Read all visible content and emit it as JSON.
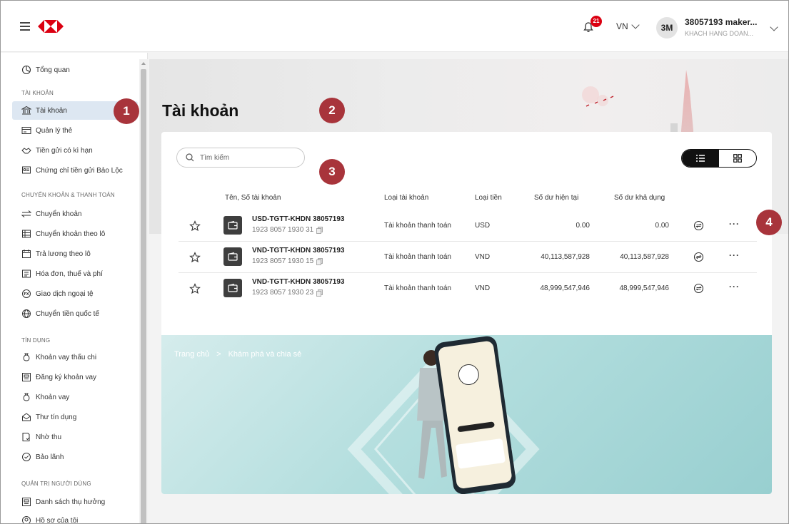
{
  "header": {
    "notifications_count": "21",
    "language": "VN",
    "avatar_initials": "3M",
    "user_name": "38057193 maker...",
    "user_company": "KHACH HANG DOAN..."
  },
  "sidebar": {
    "overview": "Tổng quan",
    "sections": {
      "accounts": "TÀI KHOẢN",
      "transfers": "CHUYỂN KHOẢN & THANH TOÁN",
      "credit": "TÍN DỤNG",
      "admin": "QUẢN TRỊ NGƯỜI DÙNG"
    },
    "accounts_items": [
      "Tài khoản",
      "Quản lý thẻ",
      "Tiền gửi có kì hạn",
      "Chứng chỉ tiền gửi Bảo Lộc"
    ],
    "transfer_items": [
      "Chuyển khoản",
      "Chuyển khoản theo lô",
      "Trả lương theo lô",
      "Hóa đơn, thuế và phí",
      "Giao dịch ngoại tệ",
      "Chuyển tiền quốc tế"
    ],
    "credit_items": [
      "Khoản vay thấu chi",
      "Đăng ký khoản vay",
      "Khoản vay",
      "Thư tín dụng",
      "Nhờ thu",
      "Bảo lãnh"
    ],
    "admin_items": [
      "Danh sách thụ hưởng",
      "Hồ sơ của tôi"
    ]
  },
  "main": {
    "title": "Tài khoản",
    "search_placeholder": "Tìm kiếm",
    "columns": {
      "name": "Tên, Số tài khoản",
      "type": "Loại tài khoản",
      "currency": "Loại tiền",
      "current_balance": "Số dư hiện tại",
      "available_balance": "Số dư khả dụng"
    },
    "accounts": [
      {
        "name": "USD-TGTT-KHDN 38057193",
        "number": "1923 8057 1930 31",
        "type": "Tài khoản thanh toán",
        "currency": "USD",
        "current": "0.00",
        "available": "0.00"
      },
      {
        "name": "VND-TGTT-KHDN 38057193",
        "number": "1923 8057 1930 15",
        "type": "Tài khoản thanh toán",
        "currency": "VND",
        "current": "40,113,587,928",
        "available": "40,113,587,928"
      },
      {
        "name": "VND-TGTT-KHDN 38057193",
        "number": "1923 8057 1930 23",
        "type": "Tài khoản thanh toán",
        "currency": "VND",
        "current": "48,999,547,946",
        "available": "48,999,547,946"
      }
    ],
    "more_label": "···",
    "breadcrumb": {
      "home": "Trang chủ",
      "separator": ">",
      "current": "Khám phá và chia sẻ"
    }
  },
  "callouts": [
    "1",
    "2",
    "3",
    "4"
  ],
  "colors": {
    "brand_red": "#db0011",
    "callout": "#a8343b",
    "active_nav": "#dde7f2"
  }
}
